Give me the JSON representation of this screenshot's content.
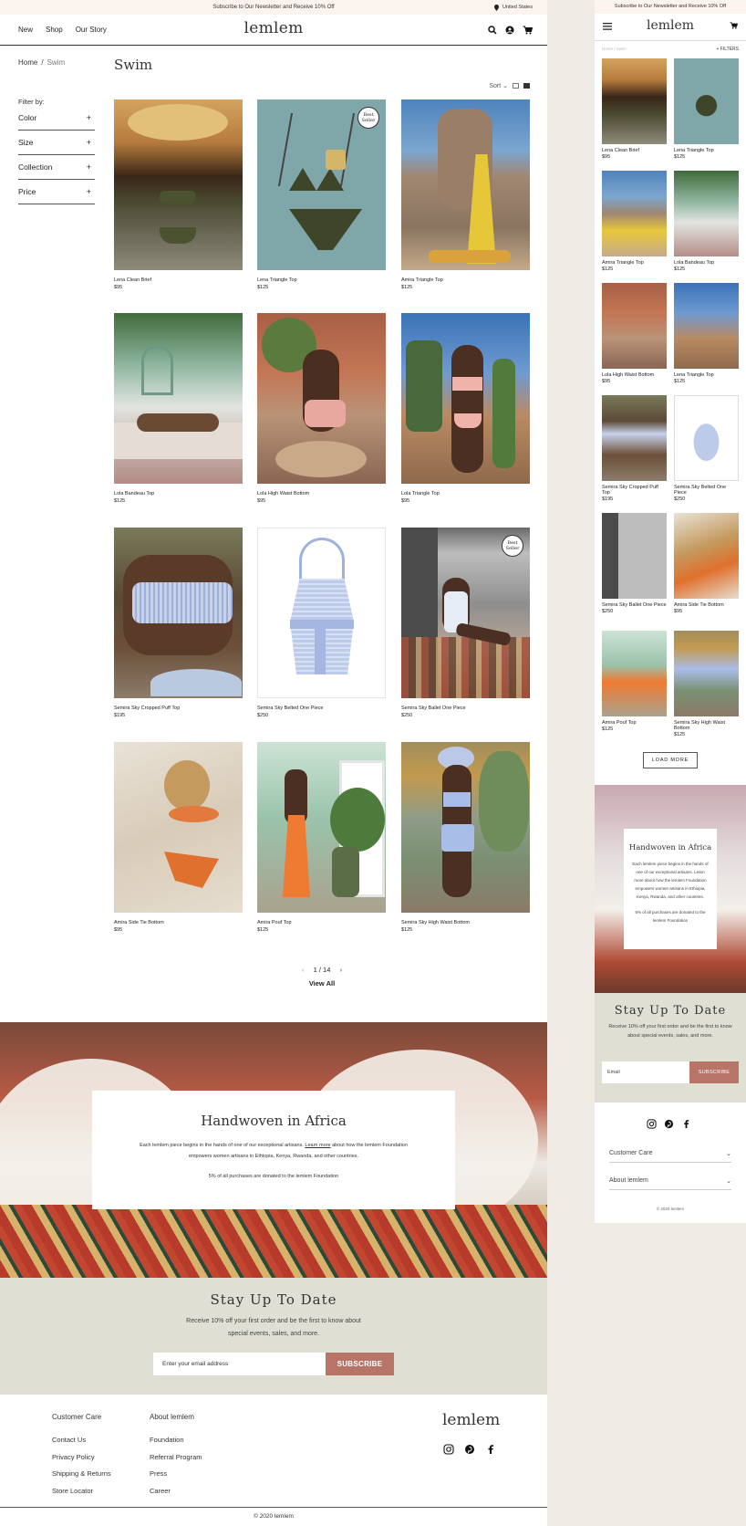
{
  "desktop": {
    "promo": "Subscribe to Our Newsletter and Receive 10% Off",
    "country": "United States",
    "nav": [
      "New",
      "Shop",
      "Our Story"
    ],
    "logo": "lemlem",
    "icons": [
      "search-icon",
      "account-icon",
      "cart-icon"
    ],
    "breadcrumb": {
      "home": "Home",
      "sep": "/",
      "current": "Swim"
    },
    "page_title": "Swim",
    "sort_label": "Sort",
    "filter_title": "Filter by:",
    "filters": [
      "Color",
      "Size",
      "Collection",
      "Price"
    ],
    "filter_toggle": "+",
    "best_seller": "Best Seller",
    "products": [
      {
        "name": "Lena Clean Brief",
        "price": "$95"
      },
      {
        "name": "Lena Triangle Top",
        "price": "$125",
        "badge": true
      },
      {
        "name": "Amira Triangle Top",
        "price": "$125"
      },
      {
        "name": "Lola Bandeau Top",
        "price": "$125"
      },
      {
        "name": "Lola High Waist Bottom",
        "price": "$95"
      },
      {
        "name": "Lola Triangle Top",
        "price": "$95"
      },
      {
        "name": "Semira Sky Cropped Puff Top",
        "price": "$195"
      },
      {
        "name": "Semira Sky Belted One Piece",
        "price": "$250"
      },
      {
        "name": "Semira Sky Ballet One Piece",
        "price": "$250",
        "badge": true
      },
      {
        "name": "Amira Side Tie Bottom",
        "price": "$95"
      },
      {
        "name": "Amira Pouf Top",
        "price": "$125"
      },
      {
        "name": "Semira Sky High Waist Bottom",
        "price": "$125"
      }
    ],
    "pager": {
      "prev": "‹",
      "current": "1 / 14",
      "next": "›",
      "view_all": "View All"
    },
    "hero": {
      "title": "Handwoven in Africa",
      "body_pre": "Each lemlem piece begins in the hands of one of our exceptional artisans.",
      "learn_more": "Learn more",
      "body_post": "about how the lemlem Foundation empowers women artisans in Ethiopia, Kenya, Rwanda, and other countries.",
      "note": "5% of all purchases are donated to the lemlem Foundation"
    },
    "newsletter": {
      "title": "Stay Up To Date",
      "body": "Receive 10% off your first order and be the first to know about special events, sales, and more.",
      "placeholder": "Enter your email address",
      "button": "SUBSCRIBE"
    },
    "footer": {
      "customer_care": {
        "title": "Customer Care",
        "links": [
          "Contact Us",
          "Privacy Policy",
          "Shipping & Returns",
          "Store Locator"
        ]
      },
      "about": {
        "title": "About lemlem",
        "links": [
          "Foundation",
          "Referral Program",
          "Press",
          "Career"
        ]
      },
      "logo": "lemlem",
      "social": [
        "instagram-icon",
        "pinterest-icon",
        "facebook-icon"
      ],
      "copyright": "© 2020 lemlem"
    }
  },
  "mobile": {
    "promo": "Subscribe to Our Newsletter and Receive 10% Off",
    "logo": "lemlem",
    "crumbs": "Home  /  Swim",
    "filters": "+ FILTERS",
    "products": [
      {
        "name": "Lena Clean Brief",
        "price": "$95"
      },
      {
        "name": "Lena Triangle Top",
        "price": "$125"
      },
      {
        "name": "Amira Triangle Top",
        "price": "$125"
      },
      {
        "name": "Lola Bandeau Top",
        "price": "$125"
      },
      {
        "name": "Lola High Waist Bottom",
        "price": "$95"
      },
      {
        "name": "Lena Triangle Top",
        "price": "$125"
      },
      {
        "name": "Semira Sky Cropped Puff Top",
        "price": "$195"
      },
      {
        "name": "Semira Sky Belted One Piece",
        "price": "$250"
      },
      {
        "name": "Semira Sky Ballet One Piece",
        "price": "$250"
      },
      {
        "name": "Amira Side Tie Bottom",
        "price": "$95"
      },
      {
        "name": "Amira Pouf Top",
        "price": "$125"
      },
      {
        "name": "Semira Sky High Waist Bottom",
        "price": "$125"
      }
    ],
    "load_more": "LOAD MORE",
    "hero": {
      "title": "Handwoven in Africa",
      "body": "Each lemlem piece begins in the hands of one of our exceptional artisans. Learn more about how the lemlem Foundation empowers women artisans in Ethiopia, Kenya, Rwanda, and other countries.",
      "note": "5% of all purchases are donated to the lemlem Foundation"
    },
    "newsletter": {
      "title": "Stay Up To Date",
      "body": "Receive 10% off your first order and be the first to know about special events, sales, and more.",
      "placeholder": "Email",
      "button": "SUBSCRIBE"
    },
    "accordion": [
      "Customer Care",
      "About lemlem"
    ],
    "copyright": "© 2020 lemlem"
  },
  "colors": {
    "accent": "#b87466",
    "newsletter_bg": "#dfe0d3",
    "promo_bg": "#fbf4ee",
    "page_bg": "#efebe4"
  }
}
